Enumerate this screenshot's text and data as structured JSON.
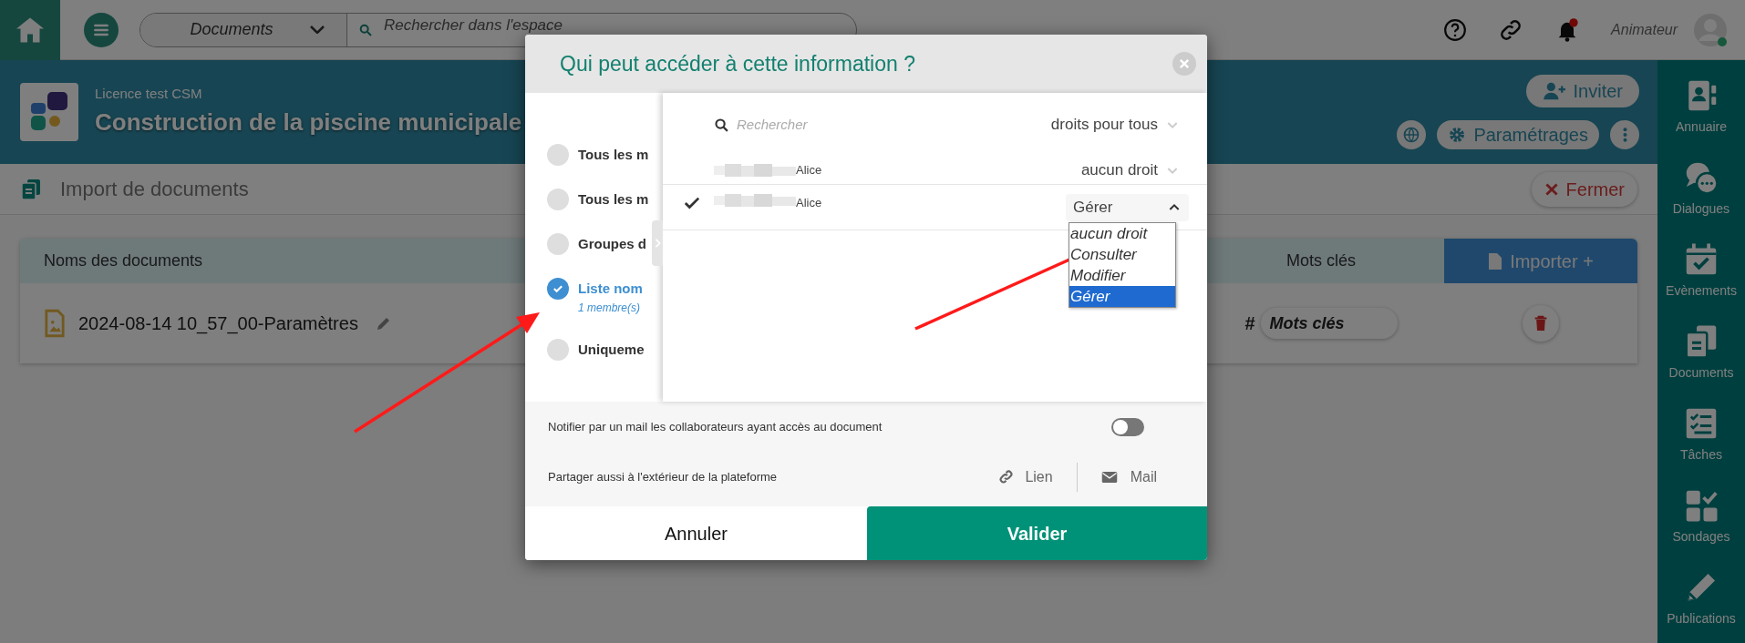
{
  "topbar": {
    "search_scope": "Documents",
    "search_placeholder": "Rechercher dans l'espace",
    "user": "Animateur"
  },
  "project": {
    "license": "Licence test CSM",
    "title": "Construction de la piscine municipale",
    "invite": "Inviter",
    "settings": "Paramétrages"
  },
  "page": {
    "title": "Import de documents",
    "close": "Fermer"
  },
  "table": {
    "columns": [
      "Noms des documents",
      "Mots clés"
    ],
    "import_button": "Importer +",
    "rows": [
      {
        "name": "2024-08-14 10_57_00-Paramètres",
        "keyword_hash": "#",
        "keywords": "Mots clés"
      }
    ]
  },
  "sidebar": {
    "items": [
      {
        "label": "Annuaire"
      },
      {
        "label": "Dialogues"
      },
      {
        "label": "Evènements"
      },
      {
        "label": "Documents"
      },
      {
        "label": "Tâches"
      },
      {
        "label": "Sondages"
      },
      {
        "label": "Publications"
      }
    ]
  },
  "dialog": {
    "title": "Qui peut accéder à cette information ?",
    "options": [
      {
        "label": "Tous les m",
        "selected": false
      },
      {
        "label": "Tous les m",
        "selected": false
      },
      {
        "label": "Groupes d",
        "selected": false
      },
      {
        "label": "Liste nom",
        "sublabel": "1 membre(s)",
        "selected": true
      },
      {
        "label": "Uniqueme",
        "selected": false
      }
    ],
    "search_placeholder": "Rechercher",
    "rights_all": "droits pour tous",
    "members": [
      {
        "name": "Alice",
        "checked": false,
        "right": "aucun droit",
        "expanded": false
      },
      {
        "name": "Alice",
        "checked": true,
        "right": "Gérer",
        "expanded": true,
        "options": [
          {
            "label": "aucun droit",
            "selected": false
          },
          {
            "label": "Consulter",
            "selected": false
          },
          {
            "label": "Modifier",
            "selected": false
          },
          {
            "label": "Gérer",
            "selected": true
          }
        ]
      }
    ],
    "notify": {
      "label": "Notifier par un mail les collaborateurs ayant accès au document",
      "on": false
    },
    "share": {
      "label": "Partager aussi à l'extérieur de la plateforme",
      "link": "Lien",
      "mail": "Mail"
    },
    "cancel": "Annuler",
    "confirm": "Valider"
  }
}
